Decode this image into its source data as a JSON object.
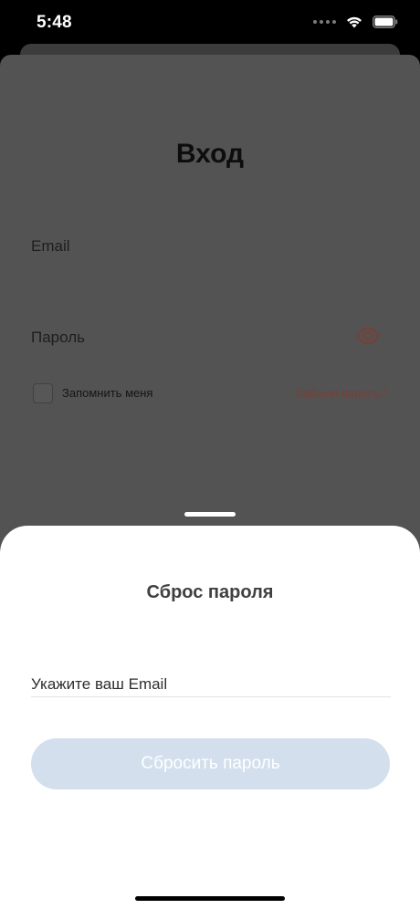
{
  "status_bar": {
    "time": "5:48",
    "icons": [
      "signal-dots-icon",
      "wifi-icon",
      "battery-icon"
    ]
  },
  "login": {
    "title": "Вход",
    "email_label": "Email",
    "password_label": "Пароль",
    "remember_label": "Запомнить меня",
    "remember_checked": false,
    "forgot_link": "Забыли пароль?",
    "accent_color": "#7a3f36"
  },
  "reset_sheet": {
    "title": "Сброс пароля",
    "email_placeholder": "Укажите ваш Email",
    "email_value": "",
    "submit_label": "Сбросить пароль",
    "submit_color": "#d3dfed"
  }
}
